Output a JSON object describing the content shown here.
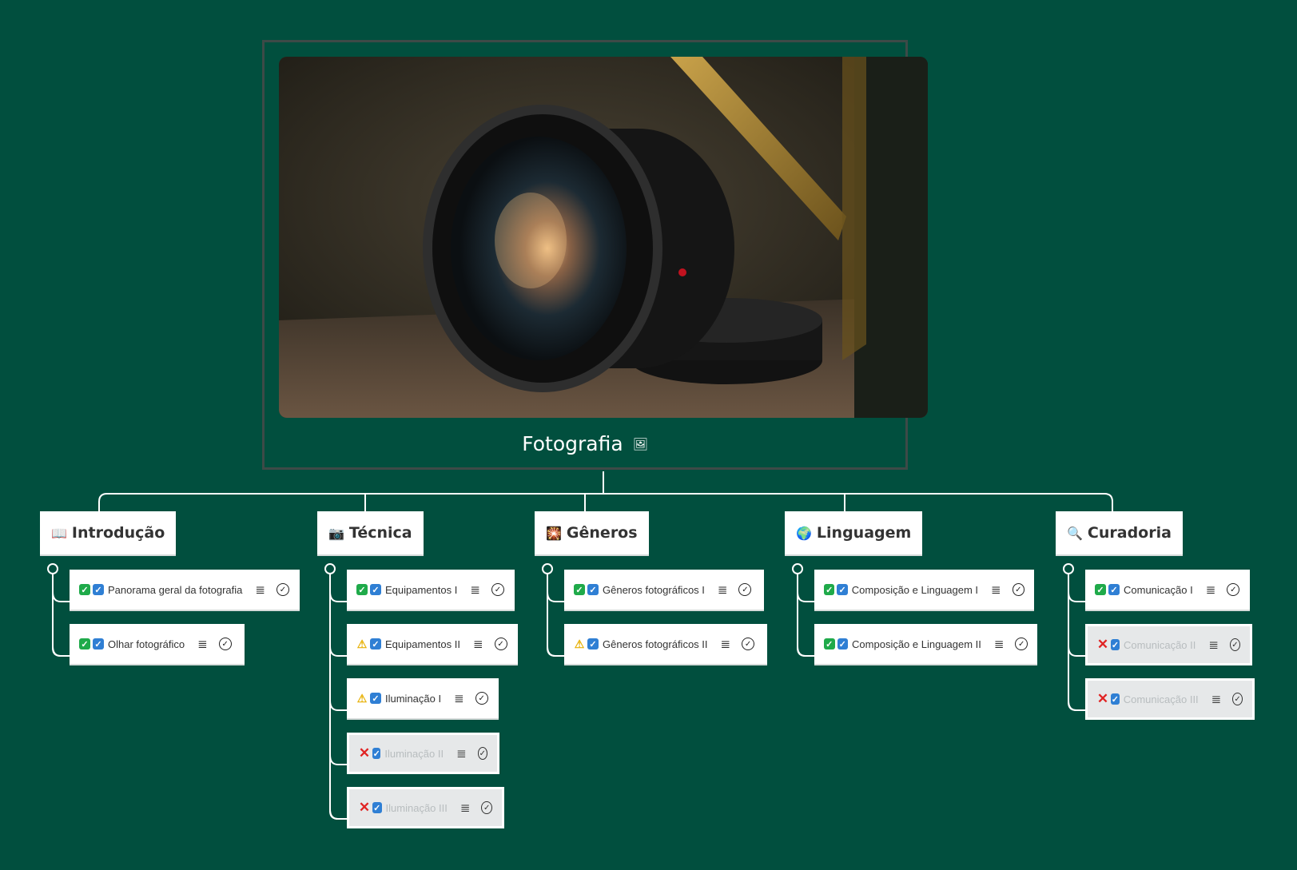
{
  "root": {
    "title": "Fotografia",
    "image_alt": "camera lens photo"
  },
  "branches": [
    {
      "icon": "📖",
      "title": "Introdução",
      "items": [
        {
          "status": "ok",
          "label": "Panorama geral da fotografia",
          "disabled": false
        },
        {
          "status": "ok",
          "label": "Olhar fotográfico",
          "disabled": false
        }
      ]
    },
    {
      "icon": "📷",
      "title": "Técnica",
      "items": [
        {
          "status": "ok",
          "label": "Equipamentos I",
          "disabled": false
        },
        {
          "status": "warn",
          "label": "Equipamentos II",
          "disabled": false
        },
        {
          "status": "warn",
          "label": "Iluminação I",
          "disabled": false
        },
        {
          "status": "no",
          "label": "Iluminação II",
          "disabled": true
        },
        {
          "status": "no",
          "label": "Iluminação III",
          "disabled": true
        }
      ]
    },
    {
      "icon": "🎇",
      "title": "Gêneros",
      "items": [
        {
          "status": "ok",
          "label": "Gêneros fotográficos I",
          "disabled": false
        },
        {
          "status": "warn",
          "label": "Gêneros fotográficos II",
          "disabled": false
        }
      ]
    },
    {
      "icon": "🌍",
      "title": "Linguagem",
      "items": [
        {
          "status": "ok",
          "label": "Composição e Linguagem I",
          "disabled": false
        },
        {
          "status": "ok",
          "label": "Composição e Linguagem II",
          "disabled": false
        }
      ]
    },
    {
      "icon": "🔍",
      "title": "Curadoria",
      "items": [
        {
          "status": "ok",
          "label": "Comunicação I",
          "disabled": false
        },
        {
          "status": "no",
          "label": "Comunicação II",
          "disabled": true
        },
        {
          "status": "no",
          "label": "Comunicação III",
          "disabled": true
        }
      ]
    }
  ],
  "colors": {
    "background": "#014f3e",
    "line": "#ffffff",
    "node": "#ffffff",
    "node_disabled": "#e6e8e9"
  }
}
